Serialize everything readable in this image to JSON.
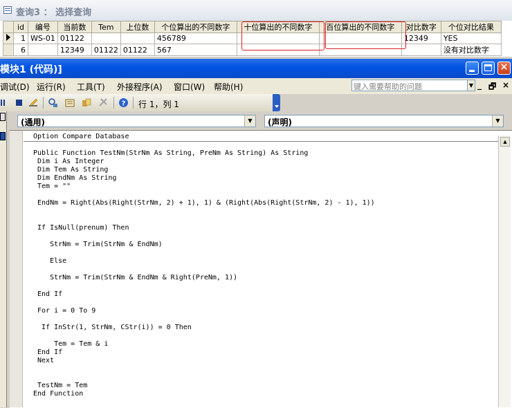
{
  "query_window": {
    "title": "查询3 ： 选择查询",
    "columns": [
      "id",
      "编号",
      "当前数",
      "Tem",
      "上位数",
      "个位算出的不同数字",
      "十位算出的不同数字",
      "百位算出的不同数字",
      "对比数字",
      "个位对比结果"
    ],
    "rows": [
      [
        "1",
        "WS-01",
        "01122",
        "",
        "",
        "456789",
        "",
        "",
        "12349",
        "YES"
      ],
      [
        "6",
        "",
        "12349",
        "01122",
        "01122",
        "567",
        "",
        "",
        "",
        "没有对比数字"
      ]
    ]
  },
  "vbe_window": {
    "title": "模块1 (代码)]",
    "controls": {
      "minimize": "_",
      "maximize": "□",
      "close": "×"
    }
  },
  "menu": {
    "items": [
      "调试(D)",
      "运行(R)",
      "工具(T)",
      "外接程序(A)",
      "窗口(W)",
      "帮助(H)"
    ],
    "help_placeholder": "键入需要帮助的问题",
    "mdi_controls": [
      "_",
      "🗗",
      "×"
    ]
  },
  "toolbar": {
    "position_text": "行 1，列 1"
  },
  "combos": {
    "object": "(通用)",
    "procedure": "(声明)"
  },
  "code_lines": [
    "Option Compare Database",
    "",
    "Public Function TestNm(StrNm As String, PreNm As String) As String",
    " Dim i As Integer",
    " Dim Tem As String",
    " Dim EndNm As String",
    " Tem = \"\"",
    "",
    " EndNm = Right(Abs(Right(StrNm, 2) + 1), 1) & (Right(Abs(Right(StrNm, 2) - 1), 1))",
    "",
    "",
    " If IsNull(prenum) Then",
    "",
    "    StrNm = Trim(StrNm & EndNm)",
    "",
    "    Else",
    "",
    "    StrNm = Trim(StrNm & EndNm & Right(PreNm, 1))",
    "",
    " End If",
    "",
    " For i = 0 To 9",
    "",
    "  If InStr(1, StrNm, CStr(i)) = 0 Then",
    "",
    "     Tem = Tem & i",
    " End If",
    " Next",
    "",
    "",
    " TestNm = Tem",
    "End Function"
  ]
}
